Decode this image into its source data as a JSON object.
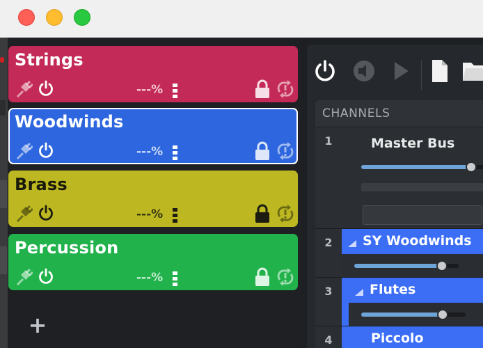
{
  "window": {
    "controls": {
      "close_color": "#fe5f57",
      "minimize_color": "#febc2e",
      "maximize_color": "#28c840"
    }
  },
  "cards": [
    {
      "title": "Strings",
      "percent": "---%",
      "color": "#c42a57",
      "text_style": "light",
      "selected": false
    },
    {
      "title": "Woodwinds",
      "percent": "---%",
      "color": "#2d66de",
      "text_style": "light",
      "selected": true
    },
    {
      "title": "Brass",
      "percent": "---%",
      "color": "#bdb821",
      "text_style": "dark",
      "selected": false
    },
    {
      "title": "Percussion",
      "percent": "---%",
      "color": "#22b24c",
      "text_style": "light",
      "selected": false
    }
  ],
  "card_icons": [
    "plug-icon",
    "power-icon",
    "vertical-dots-icon",
    "lock-icon",
    "refresh-icon"
  ],
  "add_button": {
    "label": "+"
  },
  "toolbar": {
    "icons": [
      "power-icon",
      "speaker-icon",
      "play-icon",
      "document-icon",
      "folder-icon"
    ]
  },
  "channels": {
    "header": "CHANNELS",
    "rows": [
      {
        "number": "1",
        "name": "Master Bus",
        "level": 0.88,
        "expandable": false,
        "highlight": false
      },
      {
        "number": "2",
        "name": "SY Woodwinds",
        "level": 0.84,
        "expandable": true,
        "highlight": true
      },
      {
        "number": "3",
        "name": "Flutes",
        "level": 0.78,
        "expandable": true,
        "highlight": true
      },
      {
        "number": "4",
        "name": "Piccolo",
        "level": null,
        "expandable": false,
        "highlight": true
      }
    ]
  },
  "colors": {
    "accent_blue": "#3b6ef5",
    "slider_fill": "#6fa4d8",
    "background": "#1d1f22"
  }
}
